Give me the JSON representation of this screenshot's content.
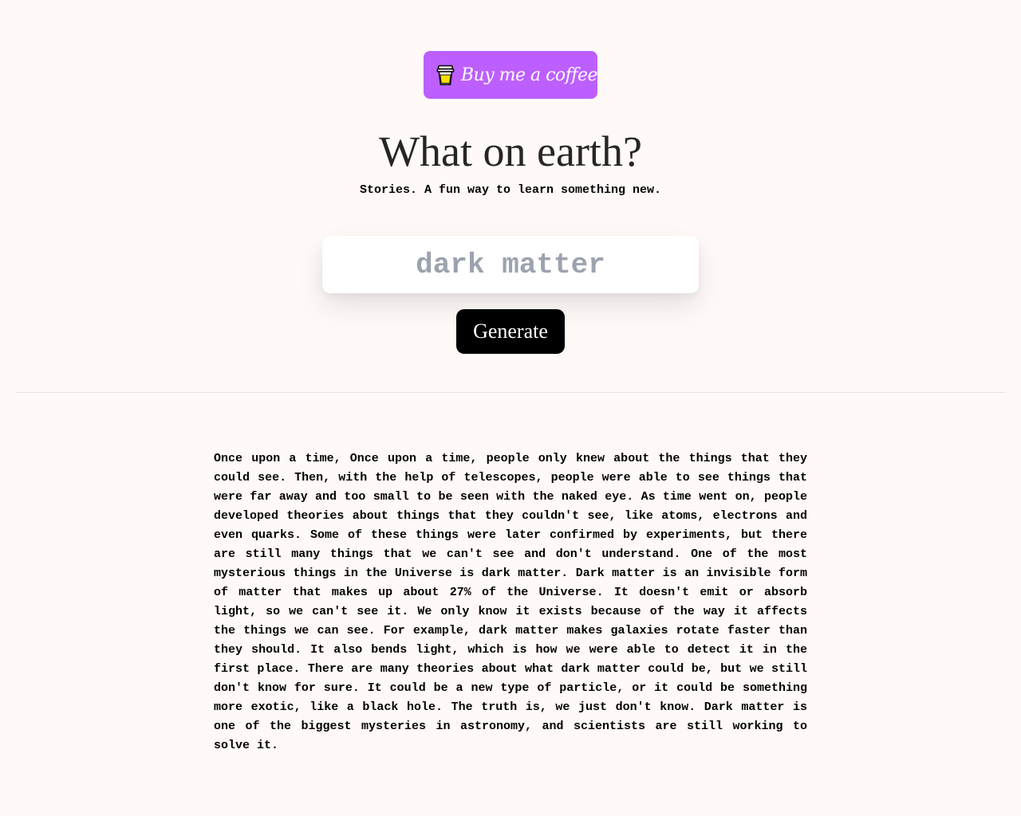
{
  "header": {
    "donate_button_label": "Buy me a coffee",
    "donate_icon": "coffee-cup-icon",
    "title": "What on earth?",
    "subtitle": "Stories. A fun way to learn something new."
  },
  "search": {
    "placeholder": "dark matter",
    "value": ""
  },
  "actions": {
    "generate_label": "Generate"
  },
  "story": {
    "text": "Once upon a time, Once upon a time, people only knew about the things that they could see. Then, with the help of telescopes, people were able to see things that were far away and too small to be seen with the naked eye. As time went on, people developed theories about things that they couldn't see, like atoms, electrons and even quarks. Some of these things were later confirmed by experiments, but there are still many things that we can't see and don't understand. One of the most mysterious things in the Universe is dark matter. Dark matter is an invisible form of matter that makes up about 27% of the Universe. It doesn't emit or absorb light, so we can't see it. We only know it exists because of the way it affects the things we can see. For example, dark matter makes galaxies rotate faster than they should. It also bends light, which is how we were able to detect it in the first place. There are many theories about what dark matter could be, but we still don't know for sure. It could be a new type of particle, or it could be something more exotic, like a black hole. The truth is, we just don't know. Dark matter is one of the biggest mysteries in astronomy, and scientists are still working to solve it."
  },
  "colors": {
    "background": "#fffaf8",
    "donate_button": "#bd5fff",
    "generate_button": "#000000",
    "title_text": "#262626",
    "placeholder_text": "#9ca3af"
  }
}
